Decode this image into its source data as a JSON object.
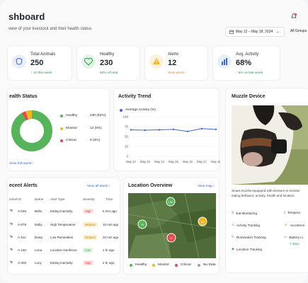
{
  "header": {
    "title": "shboard",
    "subtitle": "view of your livestock and their health status",
    "date_range": "May 12 – May 18, 2024",
    "groups_label": "All Groups"
  },
  "stats": [
    {
      "label": "Total Animals",
      "value": "250",
      "sub": "↑ 12 this week",
      "sub_color": "#1f9d4c"
    },
    {
      "label": "Healthy",
      "value": "230",
      "sub": "92% of total",
      "sub_color": "#1f9d4c"
    },
    {
      "label": "Alerts",
      "value": "12",
      "sub": "View alerts ›",
      "sub_color": "#d8901a"
    },
    {
      "label": "Avg. Activity",
      "value": "68%",
      "sub": "↑ 6% vs last week",
      "sub_color": "#1f9d4c"
    }
  ],
  "health_status": {
    "title": "ealth Status",
    "legend": [
      {
        "label": "Healthy",
        "value": "230 (92%)",
        "color": "#58b45a"
      },
      {
        "label": "Monitor",
        "value": "12 (5%)",
        "color": "#f2b61d"
      },
      {
        "label": "Critical",
        "value": "8 (3%)",
        "color": "#e5484d"
      }
    ],
    "link": "View full report ›"
  },
  "activity": {
    "title": "Activity Trend",
    "legend": "Average Activity (%)"
  },
  "chart_data": {
    "type": "line",
    "x": [
      "May 12",
      "May 13",
      "May 14",
      "May 15",
      "May 16",
      "May 17",
      "May 18"
    ],
    "series": [
      {
        "name": "Average Activity (%)",
        "values": [
          67,
          66,
          67,
          68,
          63,
          70,
          68
        ]
      }
    ],
    "ylim": [
      0,
      100
    ],
    "yticks": [
      "100",
      "75",
      "50",
      "25",
      "0"
    ],
    "grid": true
  },
  "muzzle": {
    "title": "Muzzle Device",
    "description": "Smart muzzle equipped with sensors to monitor eating behavior, activity, health and location.",
    "features": [
      {
        "label": "Eat Monitoring",
        "icon": "fork-icon"
      },
      {
        "label": "Tempera",
        "icon": "thermometer-icon"
      },
      {
        "label": "Activity Tracking",
        "icon": "activity-icon"
      },
      {
        "label": "Acceleron",
        "icon": "accelerometer-icon"
      },
      {
        "label": "Rumination Tracking",
        "icon": "rumination-icon"
      },
      {
        "label": "Battery Li",
        "icon": "battery-icon"
      },
      {
        "label": "Location Tracking",
        "icon": "location-icon"
      },
      {
        "label": "7 days",
        "icon": ""
      }
    ]
  },
  "alerts": {
    "title": "ecent Alerts",
    "link": "View all alerts ›",
    "columns": [
      "nimal ID",
      "Name",
      "Alert Type",
      "Severity",
      "Time"
    ],
    "rows": [
      {
        "id": "A-045",
        "name": "Bella",
        "type": "Eating Inactivity",
        "severity": "High",
        "time": "5 min ago"
      },
      {
        "id": "A-078",
        "name": "Molly",
        "type": "High Temperature",
        "severity": "Medium",
        "time": "15 min ago"
      },
      {
        "id": "A-112",
        "name": "Daisy",
        "type": "Low Rumination",
        "severity": "Medium",
        "time": "32 min ago"
      },
      {
        "id": "A-150",
        "name": "Luna",
        "type": "Location Geofence",
        "severity": "Low",
        "time": "1 hr ago"
      },
      {
        "id": "A-200",
        "name": "Lucy",
        "type": "Eating Inactivity",
        "severity": "High",
        "time": "2 hr ago"
      }
    ]
  },
  "location": {
    "title": "Location Overview",
    "link": "View map ›",
    "markers": [
      "100",
      "70",
      "28",
      "12"
    ],
    "legend": [
      {
        "label": "Healthy",
        "color": "#58b45a"
      },
      {
        "label": "Monitor",
        "color": "#f2b61d"
      },
      {
        "label": "Critical",
        "color": "#e5484d"
      },
      {
        "label": "No Data",
        "color": "#9aa0a6"
      }
    ]
  }
}
